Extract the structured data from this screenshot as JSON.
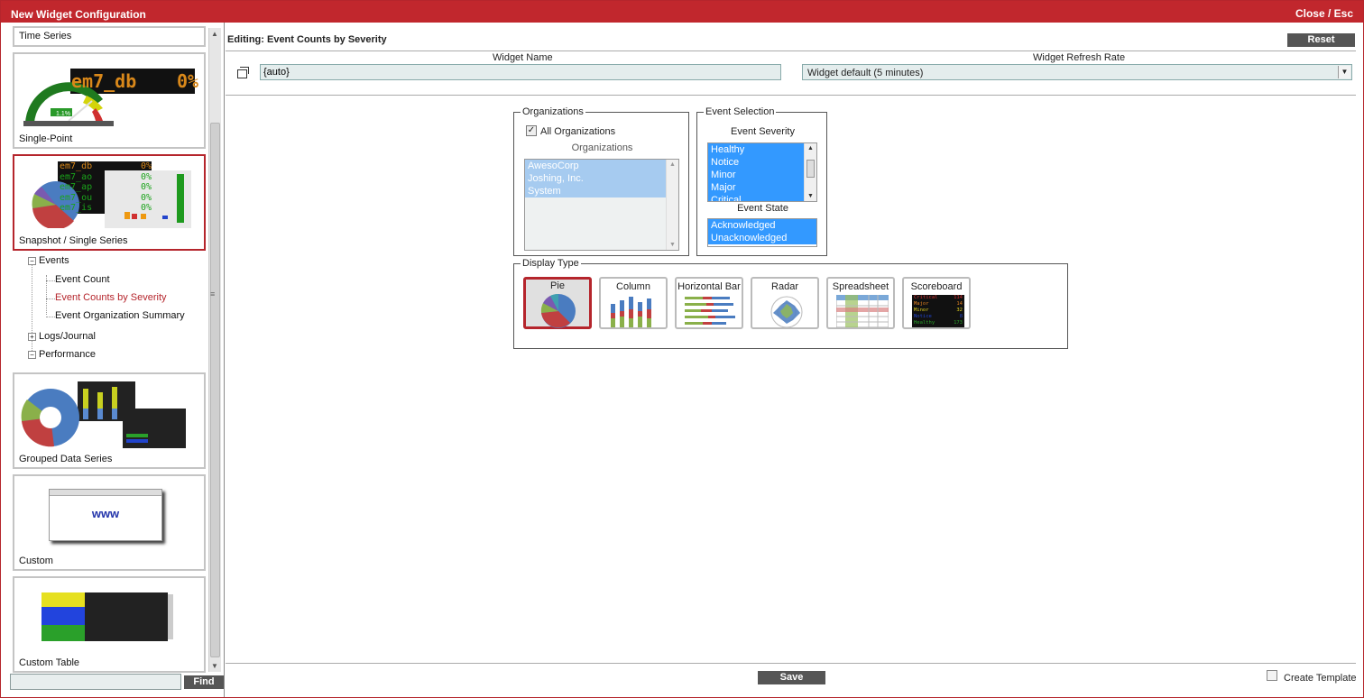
{
  "window": {
    "title": "New Widget Configuration",
    "close_label": "Close / Esc"
  },
  "left": {
    "cards": [
      {
        "label": "Time Series"
      },
      {
        "label": "Single-Point",
        "gauge_value": "1.1%",
        "readout": "em7_db",
        "readout_value": "0%"
      },
      {
        "label": "Snapshot / Single Series"
      },
      {
        "label": "Grouped Data Series"
      },
      {
        "label": "Custom",
        "www": "www"
      },
      {
        "label": "Custom Table"
      }
    ],
    "snapshot_rows": [
      {
        "name": "em7_db",
        "val": "0%"
      },
      {
        "name": "em7_ao",
        "val": "0%"
      },
      {
        "name": "em7_ap",
        "val": "0%"
      },
      {
        "name": "em7_ou",
        "val": "0%"
      },
      {
        "name": "em7_is",
        "val": "0%"
      }
    ],
    "tree": {
      "events": "Events",
      "event_count": "Event Count",
      "event_counts_by_severity": "Event Counts by Severity",
      "event_org_summary": "Event Organization Summary",
      "logs": "Logs/Journal",
      "performance": "Performance"
    },
    "find_value": "",
    "find_label": "Find"
  },
  "editor": {
    "editing_title": "Editing: Event Counts by Severity",
    "reset_label": "Reset",
    "widget_name_label": "Widget Name",
    "widget_name_value": "{auto}",
    "refresh_label": "Widget Refresh Rate",
    "refresh_value": "Widget default (5 minutes)",
    "organizations": {
      "legend": "Organizations",
      "all_label": "All Organizations",
      "all_checked": true,
      "list_label": "Organizations",
      "items": [
        "AwesoCorp",
        "Joshing, Inc.",
        "System"
      ]
    },
    "event_selection": {
      "legend": "Event Selection",
      "severity_label": "Event Severity",
      "severities": [
        "Healthy",
        "Notice",
        "Minor",
        "Major",
        "Critical"
      ],
      "state_label": "Event State",
      "states": [
        "Acknowledged",
        "Unacknowledged"
      ]
    },
    "display_type": {
      "legend": "Display Type",
      "options": [
        "Pie",
        "Column",
        "Horizontal Bar",
        "Radar",
        "Spreadsheet",
        "Scoreboard"
      ],
      "selected": "Pie",
      "scoreboard_rows": [
        {
          "label": "Critical",
          "value": "114"
        },
        {
          "label": "Major",
          "value": "14"
        },
        {
          "label": "Minor",
          "value": "32"
        },
        {
          "label": "Notice",
          "value": "8"
        },
        {
          "label": "Healthy",
          "value": "173"
        }
      ]
    },
    "save_label": "Save",
    "create_template_label": "Create Template",
    "create_template_checked": false
  },
  "colors": {
    "accent": "#c1272d",
    "selection": "#3399ff",
    "button": "#555555"
  }
}
